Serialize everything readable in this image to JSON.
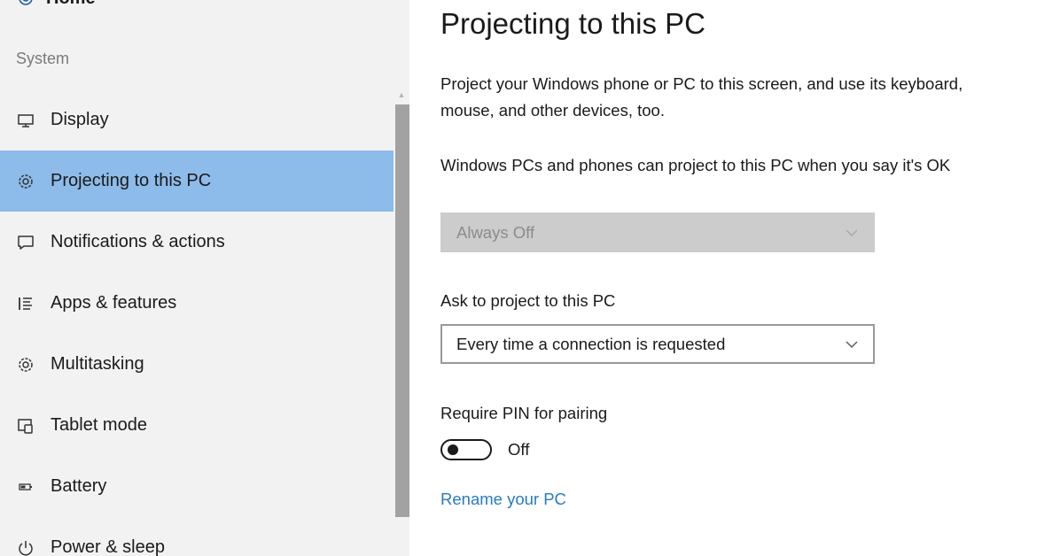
{
  "sidebar": {
    "home": {
      "label": "Home",
      "icon": "gear-icon"
    },
    "section_label": "System",
    "items": [
      {
        "label": "Display",
        "icon": "display-icon",
        "selected": false
      },
      {
        "label": "Projecting to this PC",
        "icon": "projecting-icon",
        "selected": true
      },
      {
        "label": "Notifications & actions",
        "icon": "notifications-icon",
        "selected": false
      },
      {
        "label": "Apps & features",
        "icon": "apps-features-icon",
        "selected": false
      },
      {
        "label": "Multitasking",
        "icon": "multitasking-icon",
        "selected": false
      },
      {
        "label": "Tablet mode",
        "icon": "tablet-mode-icon",
        "selected": false
      },
      {
        "label": "Battery",
        "icon": "battery-icon",
        "selected": false
      },
      {
        "label": "Power & sleep",
        "icon": "power-icon",
        "selected": false
      }
    ]
  },
  "content": {
    "title": "Projecting to this PC",
    "description": "Project your Windows phone or PC to this screen, and use its keyboard, mouse, and other devices, too.",
    "windows_pcs": {
      "label": "Windows PCs and phones can project to this PC when you say it's OK",
      "value": "Always Off",
      "enabled": false
    },
    "ask_to_project": {
      "label": "Ask to project to this PC",
      "value": "Every time a connection is requested",
      "enabled": true
    },
    "require_pin": {
      "label": "Require PIN for pairing",
      "state": "Off",
      "on": false
    },
    "rename_link": "Rename your PC"
  },
  "colors": {
    "sidebar_bg": "#f2f2f2",
    "selected_bg": "#8dbbea",
    "link": "#2a7ac0",
    "disabled_dropdown_bg": "#cccccc",
    "scrollbar_thumb": "#a2a2a2"
  }
}
